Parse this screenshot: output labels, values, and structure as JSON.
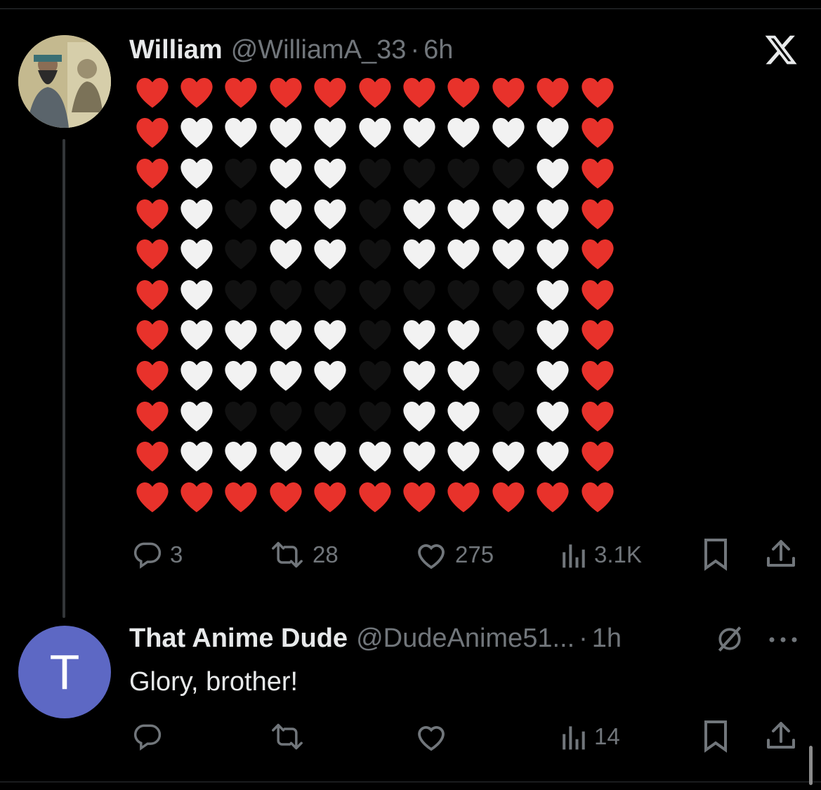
{
  "tweet": {
    "name": "William",
    "handle": "@WilliamA_33",
    "separator": "·",
    "time": "6h",
    "heart_grid": [
      "RRRRRRRRRRR",
      "RWWWWWWWWWR",
      "RWBWWBBBBWR",
      "RWBWWBWWWWR",
      "RWBWWBWWWWR",
      "RWBBBBBBBWR",
      "RWWWWBWWBWR",
      "RWWWWBWWBWR",
      "RWBBBBWWBWR",
      "RWWWWWWWWWR",
      "RRRRRRRRRRR"
    ],
    "heart_colors": {
      "R": "#e8322b",
      "W": "#f2f2f2",
      "B": "#111111"
    },
    "actions": {
      "replies": "3",
      "reposts": "28",
      "likes": "275",
      "views": "3.1K"
    }
  },
  "reply": {
    "avatar_letter": "T",
    "avatar_color": "#5d68c4",
    "name": "That Anime Dude",
    "handle": "@DudeAnime51...",
    "separator": "·",
    "time": "1h",
    "text": "Glory, brother!",
    "actions": {
      "views": "14"
    }
  },
  "icons": {
    "close": "x-logo-icon",
    "reply": "comment-icon",
    "repost": "repost-icon",
    "like": "heart-icon",
    "views": "bar-chart-icon",
    "bookmark": "bookmark-icon",
    "share": "share-icon",
    "grok": "grok-icon",
    "more": "more-icon"
  }
}
